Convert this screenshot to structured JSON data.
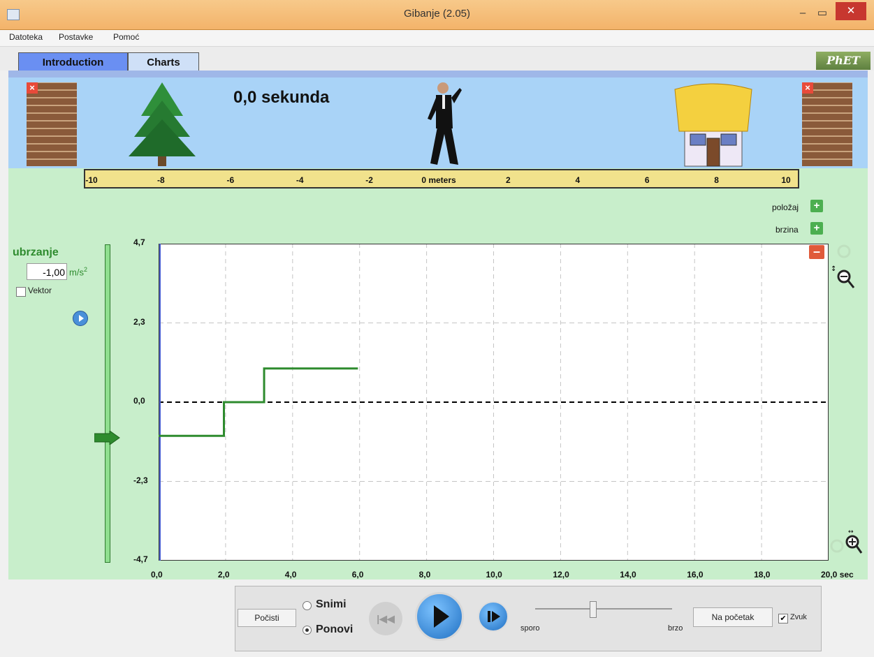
{
  "window": {
    "title": "Gibanje (2.05)"
  },
  "menu": [
    "Datoteka",
    "Postavke",
    "Pomoć"
  ],
  "tabs": {
    "introduction": "Introduction",
    "charts": "Charts"
  },
  "logo_text": "PhET",
  "scene": {
    "time_readout": "0,0 sekunda",
    "ruler_labels": [
      "-10",
      "-8",
      "-6",
      "-4",
      "-2",
      "0 meters",
      "2",
      "4",
      "6",
      "8",
      "10"
    ],
    "walker_position_m": 0
  },
  "graph_toggles": {
    "position": "položaj",
    "velocity": "brzina"
  },
  "acceleration_control": {
    "title": "ubrzanje",
    "value": "-1,00",
    "unit": "m/s",
    "unit_exp": "2",
    "vector_label": "Vektor",
    "vector_checked": false,
    "slider_value": -1.0
  },
  "chart_data": {
    "type": "line",
    "x_tick_labels": [
      "0,0",
      "2,0",
      "4,0",
      "6,0",
      "8,0",
      "10,0",
      "12,0",
      "14,0",
      "16,0",
      "18,0",
      "20,0 sec"
    ],
    "y_tick_labels": [
      "4,7",
      "2,3",
      "0,0",
      "-2,3",
      "-4,7"
    ],
    "xlim": [
      0,
      20
    ],
    "ylim": [
      -4.7,
      4.7
    ],
    "grid": true,
    "series": [
      {
        "x": [
          0,
          1.95,
          1.95,
          3.15,
          3.15,
          5.95
        ],
        "y": [
          -1.0,
          -1.0,
          0.0,
          0.0,
          1.0,
          1.0
        ],
        "color": "#2e8b2e"
      }
    ]
  },
  "controls": {
    "clear_label": "Počisti",
    "record_label": "Snimi",
    "replay_label": "Ponovi",
    "replay_selected": true,
    "slow_label": "sporo",
    "fast_label": "brzo",
    "to_start_label": "Na početak",
    "sound_label": "Zvuk",
    "sound_checked": true,
    "rewind_icon": "|◀◀"
  },
  "colors": {
    "accent_green": "#2e8b2e",
    "scene_sky": "#a9d3f7",
    "panel_green": "#c8eecb",
    "play_blue": "#1f6fc2"
  }
}
